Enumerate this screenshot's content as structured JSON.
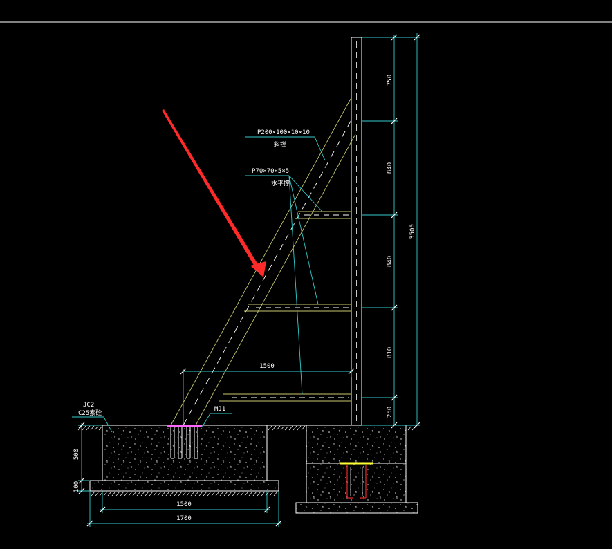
{
  "colors": {
    "background": "#000000",
    "column": "#ffffff",
    "brace": "#c8c870",
    "dimension": "#33cccc",
    "leader": "#33cccc",
    "ground": "#ffffff",
    "arrow": "#ff2a2a",
    "base_plate": "#ffff33",
    "anchor_bolt": "#cc2222",
    "embed_plate": "#ff66ff"
  },
  "labels": {
    "diag_brace_spec": "P200×100×10×10",
    "diag_brace_name": "斜撑",
    "horiz_brace_spec": "P70×70×5×5",
    "horiz_brace_name": "水平撑",
    "embed_tag": "MJ1",
    "footing_tag": "JC2",
    "concrete_grade": "C25素砼",
    "horiz_dim": "1500"
  },
  "dims": {
    "col_segments": [
      "750",
      "840",
      "840",
      "810",
      "250"
    ],
    "col_total": "3500",
    "footing_depth": "500",
    "footing_pad": "100",
    "footing_width": "1500",
    "pad_width": "1700"
  },
  "icons": {
    "pointer": "red-arrow-icon"
  }
}
